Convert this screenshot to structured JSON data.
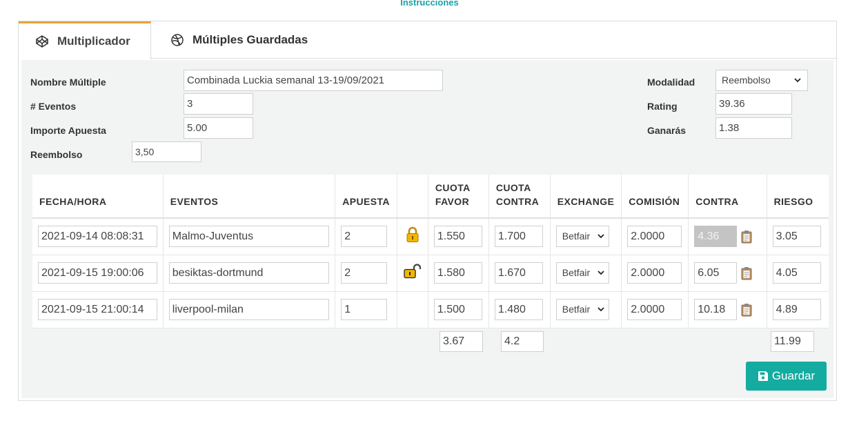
{
  "header": {
    "instructions_link": "Instrucciones"
  },
  "tabs": [
    {
      "label": "Multiplicador",
      "icon": "codepen-icon",
      "active": true
    },
    {
      "label": "Múltiples Guardadas",
      "icon": "dribbble-icon",
      "active": false
    }
  ],
  "form": {
    "nombre_label": "Nombre Múltiple",
    "nombre_value": "Combinada Luckia semanal 13-19/09/2021",
    "eventos_label": "# Eventos",
    "eventos_value": "3",
    "importe_label": "Importe Apuesta",
    "importe_value": "5.00",
    "reembolso_label": "Reembolso",
    "reembolso_value": "3,50",
    "modalidad_label": "Modalidad",
    "modalidad_value": "Reembolso",
    "rating_label": "Rating",
    "rating_value": "39.36",
    "ganaras_label": "Ganarás",
    "ganaras_value": "1.38"
  },
  "table": {
    "headers": {
      "fecha": "FECHA/HORA",
      "eventos": "EVENTOS",
      "apuesta": "APUESTA",
      "lock": "",
      "cuota_favor_1": "CUOTA",
      "cuota_favor_2": "FAVOR",
      "cuota_contra_1": "CUOTA",
      "cuota_contra_2": "CONTRA",
      "exchange": "EXCHANGE",
      "comision": "COMISIÓN",
      "contra": "CONTRA",
      "riesgo": "RIESGO"
    },
    "rows": [
      {
        "fecha": "2021-09-14 08:08:31",
        "evento": "Malmo-Juventus",
        "apuesta": "2",
        "lock": "locked",
        "cuota_favor": "1.550",
        "cuota_contra": "1.700",
        "exchange": "Betfair",
        "comision": "2.0000",
        "contra": "4.36",
        "contra_disabled": true,
        "riesgo": "3.05"
      },
      {
        "fecha": "2021-09-15 19:00:06",
        "evento": "besiktas-dortmund",
        "apuesta": "2",
        "lock": "unlocked",
        "cuota_favor": "1.580",
        "cuota_contra": "1.670",
        "exchange": "Betfair",
        "comision": "2.0000",
        "contra": "6.05",
        "contra_disabled": false,
        "riesgo": "4.05"
      },
      {
        "fecha": "2021-09-15 21:00:14",
        "evento": "liverpool-milan",
        "apuesta": "1",
        "lock": "none",
        "cuota_favor": "1.500",
        "cuota_contra": "1.480",
        "exchange": "Betfair",
        "comision": "2.0000",
        "contra": "10.18",
        "contra_disabled": false,
        "riesgo": "4.89"
      }
    ],
    "totals": {
      "cuota_favor": "3.67",
      "cuota_contra": "4.2",
      "riesgo": "11.99"
    }
  },
  "actions": {
    "save_label": "Guardar"
  },
  "colors": {
    "accent": "#14aba0",
    "tab_active_border": "#e8a33a",
    "lock": "#f2b600"
  }
}
